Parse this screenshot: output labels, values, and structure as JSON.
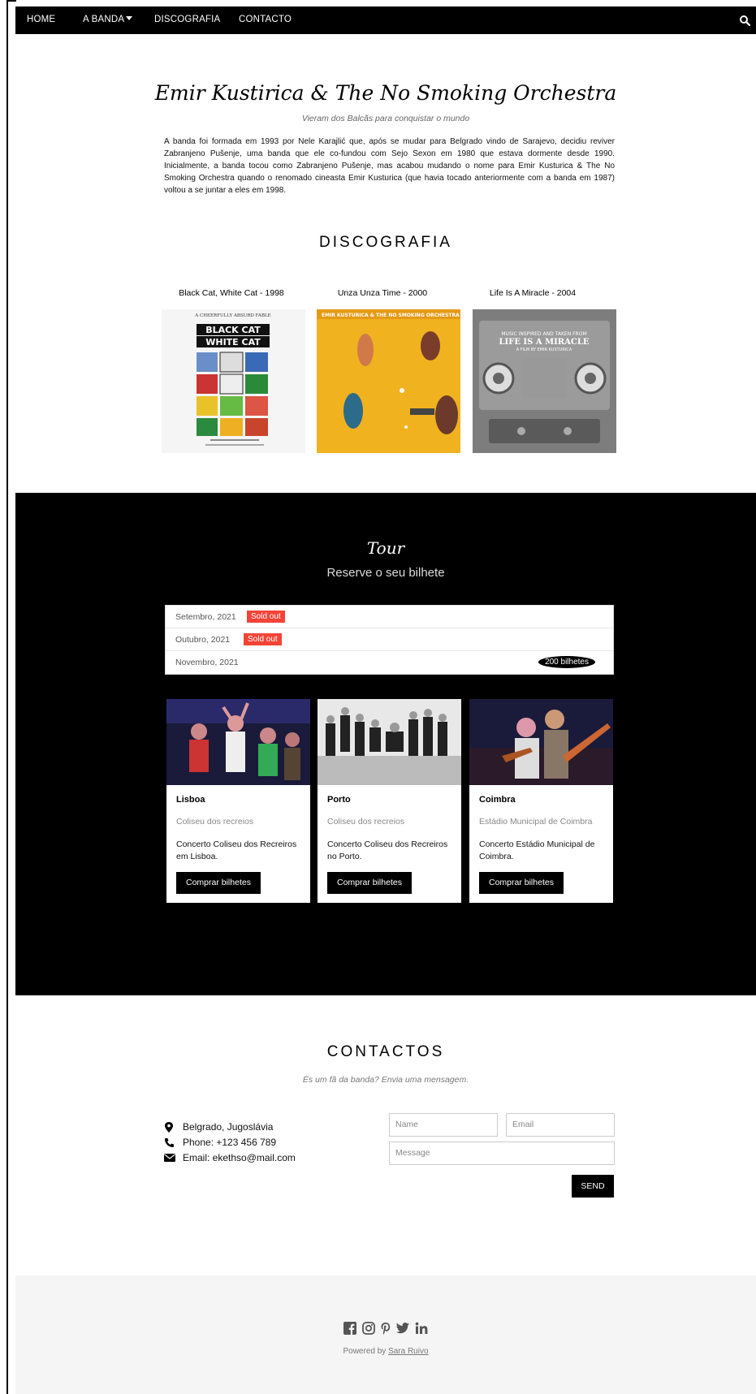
{
  "nav": {
    "items": [
      "HOME",
      "A BANDA",
      "DISCOGRAFIA",
      "CONTACTO"
    ],
    "search_icon": "search-icon"
  },
  "band": {
    "title": "Emir Kustirica & The No Smoking Orchestra",
    "subtitle": "Vieram dos Balcãs para conquistar o mundo",
    "description": "A banda foi formada em 1993 por Nele Karajlić que, após se mudar para Belgrado vindo de Sarajevo, decidiu reviver Zabranjeno Pušenje, uma banda que ele co-fundou com Sejo Sexon em 1980 que estava dormente desde 1990. Inicialmente, a banda tocou como Zabranjeno Pušenje, mas acabou mudando o nome para Emir Kusturica & The No Smoking Orchestra quando o renomado cineasta Emir Kusturica (que havia tocado anteriormente com a banda em 1987) voltou a se juntar a eles em 1998."
  },
  "discography": {
    "title": "DISCOGRAFIA",
    "albums": [
      {
        "title": "Black Cat, White Cat - 1998",
        "art_text_top": "A CHEERFULLY ABSURD FABLE",
        "art_text_main1": "BLACK CAT",
        "art_text_main2": "WHITE CAT"
      },
      {
        "title": "Unza Unza Time - 2000",
        "art_text_top": "EMIR KUSTURICA & THE NO SMOKING ORCHESTRA"
      },
      {
        "title": "Life Is A Miracle - 2004",
        "art_text_top": "MUSIC INSPIRED AND TAKEN FROM",
        "art_text_main1": "LIFE IS A MIRACLE",
        "art_text_main2": "A FILM BY EMIR KUSTURICA"
      }
    ]
  },
  "tour": {
    "title": "Tour",
    "subtitle": "Reserve o seu bilhete",
    "months": [
      {
        "label": "Setembro, 2021",
        "badge": "Sold out"
      },
      {
        "label": "Outubro, 2021",
        "badge": "Sold out"
      },
      {
        "label": "Novembro, 2021",
        "tickets": "200 bilhetes"
      }
    ],
    "cards": [
      {
        "city": "Lisboa",
        "venue": "Coliseu dos recreios",
        "description": "Concerto Coliseu dos Recreiros em Lisboa.",
        "button": "Comprar bilhetes"
      },
      {
        "city": "Porto",
        "venue": "Coliseu dos recreios",
        "description": "Concerto Coliseu dos Recreiros no Porto.",
        "button": "Comprar bilhetes"
      },
      {
        "city": "Coimbra",
        "venue": "Estádio Municipal de Coimbra",
        "description": "Concerto Estádio Municipal de Coimbra.",
        "button": "Comprar bilhetes"
      }
    ]
  },
  "contact": {
    "title": "CONTACTOS",
    "subtitle": "És um fã da banda? Envia uma mensagem.",
    "location": "Belgrado, Jugoslávia",
    "phone": "Phone: +123 456 789",
    "email": "Email: ekethso@mail.com",
    "name_placeholder": "Name",
    "email_placeholder": "Email",
    "message_placeholder": "Message",
    "send": "SEND"
  },
  "footer": {
    "powered_prefix": "Powered by",
    "powered_name": "Sara Ruivo",
    "socials": [
      "facebook-icon",
      "instagram-icon",
      "pinterest-icon",
      "twitter-icon",
      "linkedin-icon"
    ]
  },
  "colors": {
    "nav_bg": "#000000",
    "sold_out": "#f44336",
    "footer_bg": "#f5f5f5",
    "album2_bg": "#f5b71e"
  }
}
